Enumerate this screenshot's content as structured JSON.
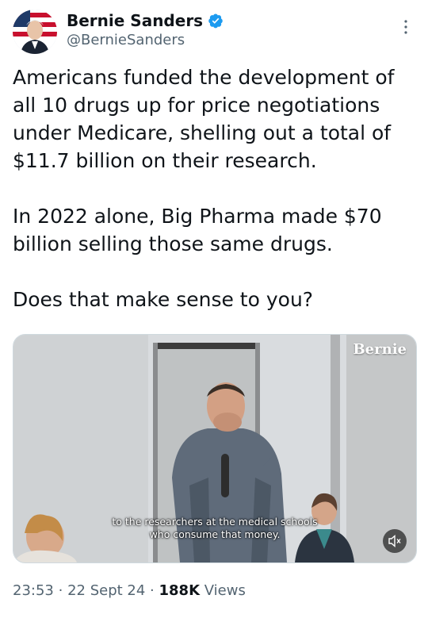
{
  "author": {
    "display_name": "Bernie Sanders",
    "handle": "@BernieSanders",
    "verified": true,
    "verified_color": "#1d9bf0"
  },
  "tweet": {
    "paragraphs": [
      "Americans funded the development of all 10 drugs up for price negotiations under Medicare, shelling out a total of $11.7 billion on their research.",
      "In 2022 alone, Big Pharma made $70 billion selling those same drugs.",
      "Does that make sense to you?"
    ]
  },
  "media": {
    "watermark": "Bernie",
    "caption_line1": "to the researchers at the medical schools",
    "caption_line2": "who consume that money."
  },
  "meta": {
    "time": "23:53",
    "date": "22 Sept 24",
    "views_count": "188K",
    "views_label": "Views"
  }
}
